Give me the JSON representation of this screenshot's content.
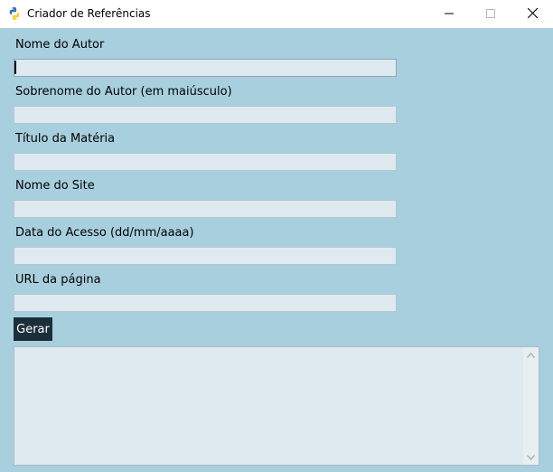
{
  "window": {
    "title": "Criador de Referências"
  },
  "form": {
    "fields": [
      {
        "label": "Nome do Autor",
        "value": ""
      },
      {
        "label": "Sobrenome do Autor (em maiúsculo)",
        "value": ""
      },
      {
        "label": "Título da Matéria",
        "value": ""
      },
      {
        "label": "Nome do Site",
        "value": ""
      },
      {
        "label": "Data do Acesso (dd/mm/aaaa)",
        "value": ""
      },
      {
        "label": "URL da página",
        "value": ""
      }
    ],
    "generate_label": "Gerar",
    "output_value": ""
  },
  "colors": {
    "background": "#a8cfde",
    "input_bg": "#deeaf0",
    "button_bg": "#1b2f3b",
    "button_text": "#ffffff"
  },
  "icons": [
    "python-icon",
    "minimize-icon",
    "maximize-icon",
    "close-icon",
    "scroll-up-icon",
    "scroll-down-icon"
  ]
}
